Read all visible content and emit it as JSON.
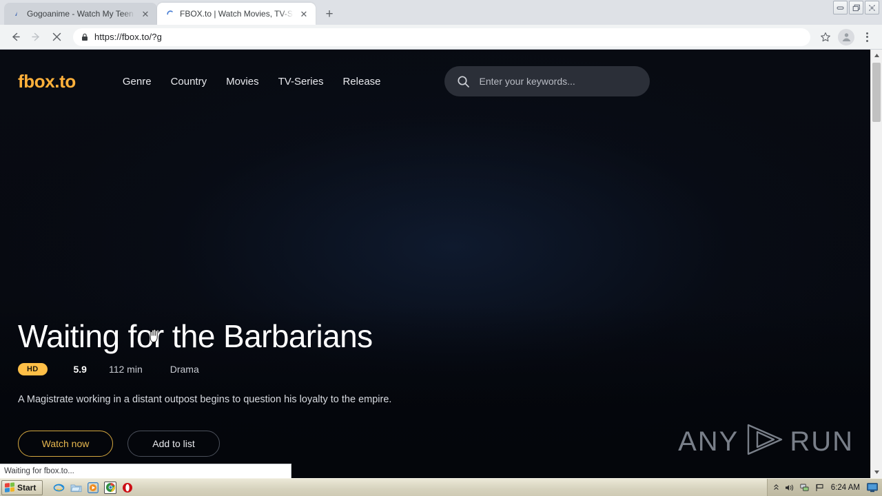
{
  "window": {
    "controls": [
      {
        "name": "minimize-button",
        "glyph": "–"
      },
      {
        "name": "restore-button",
        "glyph": "❐"
      },
      {
        "name": "close-button",
        "glyph": "✕"
      }
    ]
  },
  "browser": {
    "tabs": [
      {
        "title": "Gogoanime - Watch My Teen Roman",
        "active": false,
        "favicon": "gogoanime-favicon",
        "close_label": "✕"
      },
      {
        "title": "FBOX.to | Watch Movies, TV-Shows",
        "active": true,
        "favicon": "loading-spinner-favicon",
        "close_label": "✕"
      }
    ],
    "new_tab_label": "+",
    "toolbar": {
      "back_label": "←",
      "forward_label": "→",
      "stop_label": "✕",
      "url": "https://fbox.to/?g",
      "lock_icon": "padlock-icon",
      "bookmark_icon": "star-icon",
      "profile_icon": "account-avatar-icon",
      "menu_icon": "three-dot-menu-icon"
    },
    "status_text": "Waiting for fbox.to...",
    "scrollbar": {
      "up_label": "▲",
      "down_label": "▼"
    }
  },
  "site": {
    "logo": "fbox.to",
    "nav": [
      {
        "label": "Genre"
      },
      {
        "label": "Country"
      },
      {
        "label": "Movies"
      },
      {
        "label": "TV-Series"
      },
      {
        "label": "Release"
      }
    ],
    "search": {
      "placeholder": "Enter your keywords...",
      "value": "",
      "icon": "search-icon"
    },
    "hero": {
      "title": "Waiting for the Barbarians",
      "quality_badge": "HD",
      "rating": "5.9",
      "duration": "112 min",
      "genre": "Drama",
      "synopsis": "A Magistrate working in a distant outpost begins to question his loyalty to the empire.",
      "primary_button": "Watch now",
      "secondary_button": "Add to list"
    },
    "watermark": {
      "left": "ANY",
      "right": "RUN",
      "icon": "anyrun-play-logo"
    }
  },
  "taskbar": {
    "start_label": "Start",
    "quick_launch": [
      {
        "name": "internet-explorer-icon",
        "active": false
      },
      {
        "name": "file-explorer-icon",
        "active": false
      },
      {
        "name": "media-player-icon",
        "active": false
      },
      {
        "name": "google-chrome-icon",
        "active": true
      },
      {
        "name": "opera-icon",
        "active": false
      }
    ],
    "tray": {
      "chevron": "«",
      "volume_icon": "volume-icon",
      "network_icon": "network-icon",
      "flag_icon": "security-flag-icon",
      "clock": "6:24 AM",
      "desktop_icon": "show-desktop-icon"
    }
  },
  "colors": {
    "brand": "#ffb13b",
    "badge": "#ffbf47",
    "page_bg": "#05080f",
    "accent_button": "#e8b84f"
  }
}
